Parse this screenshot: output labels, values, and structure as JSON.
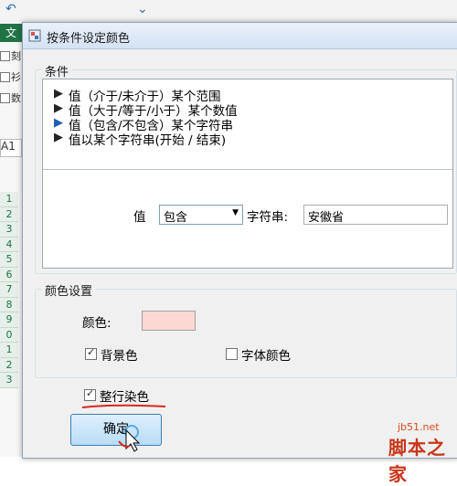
{
  "background": {
    "ribbon_tab": "文",
    "checkboxes": [
      "刻",
      "衫",
      "数"
    ],
    "name_box": "A1",
    "row_numbers": [
      "1",
      "2",
      "3",
      "4",
      "5",
      "6",
      "7",
      "8",
      "9",
      "0",
      "1",
      "2",
      "3"
    ]
  },
  "dialog": {
    "title": "按条件设定颜色",
    "conditions": {
      "legend": "条件",
      "items": [
        {
          "label": "值（介于/未介于）某个范围",
          "selected": false
        },
        {
          "label": "值（大于/等于/小于）某个数值",
          "selected": false
        },
        {
          "label": "值（包含/不包含）某个字符串",
          "selected": true
        },
        {
          "label": "值以某个字符串(开始 / 结束)",
          "selected": false
        }
      ],
      "value_label": "值",
      "operator_value": "包含",
      "string_label": "字符串:",
      "string_value": "安徽省"
    },
    "color_settings": {
      "legend": "颜色设置",
      "color_label": "颜色:",
      "color_value": "#fcd8d2",
      "background_label": "背景色",
      "background_checked": true,
      "font_color_label": "字体颜色",
      "font_color_checked": false
    },
    "whole_row_label": "整行染色",
    "whole_row_checked": true,
    "ok_label": "确定"
  },
  "watermark": {
    "site": "jb51.net",
    "name": "脚本之家"
  }
}
